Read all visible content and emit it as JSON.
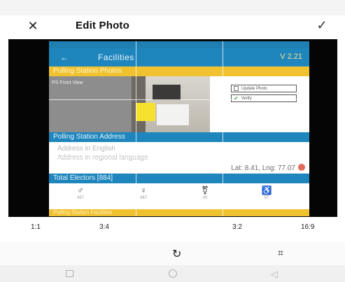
{
  "header": {
    "close_icon": "close-icon",
    "title": "Edit Photo",
    "confirm_icon": "check-icon"
  },
  "photo_app": {
    "app_title": "Facilities",
    "version": "V 2.21",
    "section_photos": "Polling Station Photos",
    "front_view_label": "PS Front View",
    "update_photo_label": "Update Photo",
    "verify_label": "Verify",
    "section_address": "Polling Station Address",
    "address_english": "Address in English",
    "address_regional": "Address in regional language",
    "lat_lng": "Lat: 8.41, Lng: 77.07",
    "section_electors": "Total Electors [884]",
    "elector_counts": [
      "437",
      "447",
      "00",
      "97"
    ],
    "section_facilities": "Polling Station Facilities"
  },
  "crop_ratios": [
    "1:1",
    "3:4",
    "3:2",
    "16:9"
  ],
  "tools": {
    "rotate_icon": "rotate-icon",
    "crop_icon": "crop-icon"
  },
  "nav": {
    "recents_icon": "recents-square-icon",
    "home_icon": "home-circle-icon",
    "back_icon": "back-triangle-icon"
  }
}
